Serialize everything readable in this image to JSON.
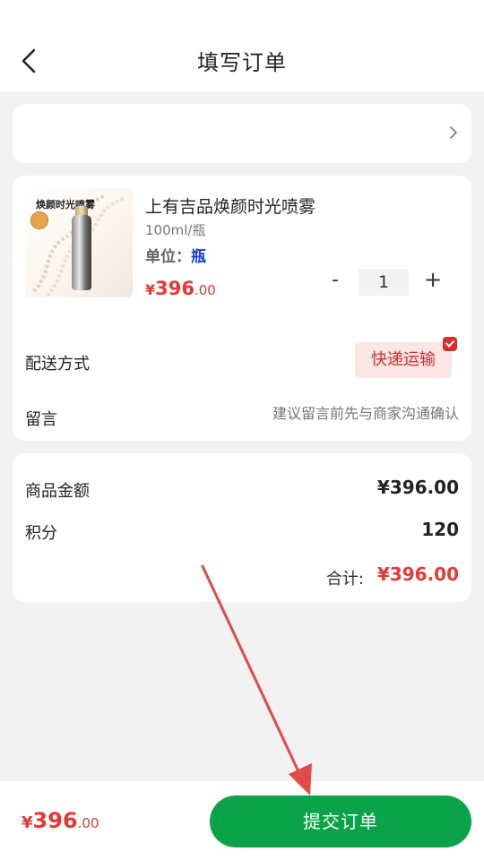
{
  "header": {
    "title": "填写订单",
    "back_icon": "chevron-left-icon"
  },
  "address": {
    "chevron_icon": "chevron-right-icon"
  },
  "product": {
    "name": "上有吉品焕颜时光喷雾",
    "spec": "100ml/瓶",
    "unit_label": "单位：",
    "unit_value": "瓶",
    "price_symbol": "¥",
    "price_integer": "396",
    "price_decimal": ".00",
    "image_caption": "焕颜时光喷雾",
    "quantity": "1",
    "qty_minus": "-",
    "qty_plus": "+"
  },
  "delivery": {
    "label": "配送方式",
    "option": "快递运输"
  },
  "message": {
    "label": "留言",
    "placeholder": "建议留言前先与商家沟通确认"
  },
  "summary": {
    "amount_label": "商品金额",
    "amount_value": "¥396.00",
    "points_label": "积分",
    "points_value": "120",
    "total_label": "合计:",
    "total_value": "¥396.00"
  },
  "footer": {
    "price_symbol": "¥",
    "price_integer": "396",
    "price_decimal": ".00",
    "submit_label": "提交订单"
  },
  "colors": {
    "accent_green": "#0aa34a",
    "price_red": "#e53935",
    "unit_blue": "#1a3fd1",
    "annotation_arrow": "#e24a4a"
  }
}
